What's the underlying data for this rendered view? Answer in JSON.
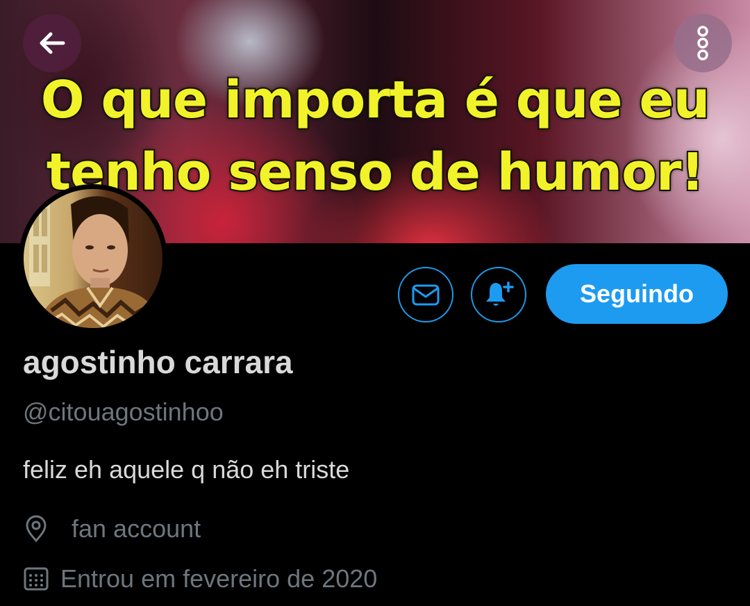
{
  "banner": {
    "caption_line1": "O que importa é que eu",
    "caption_line2": "tenho senso de humor!"
  },
  "nav": {
    "back_icon": "arrow-left-icon",
    "more_icon": "more-vertical-icon"
  },
  "profile": {
    "display_name": "agostinho carrara",
    "handle": "@citouagostinhoo",
    "bio": "feliz eh aquele q não eh triste",
    "location": "fan account",
    "joined": "Entrou em fevereiro de 2020"
  },
  "actions": {
    "message_icon": "envelope-icon",
    "notify_icon": "bell-plus-icon",
    "follow_label": "Seguindo"
  },
  "colors": {
    "accent": "#1d9bf0",
    "background": "#000000",
    "text_primary": "#d9d9d9",
    "text_secondary": "#6e767d",
    "caption_yellow": "#f2f22a"
  }
}
